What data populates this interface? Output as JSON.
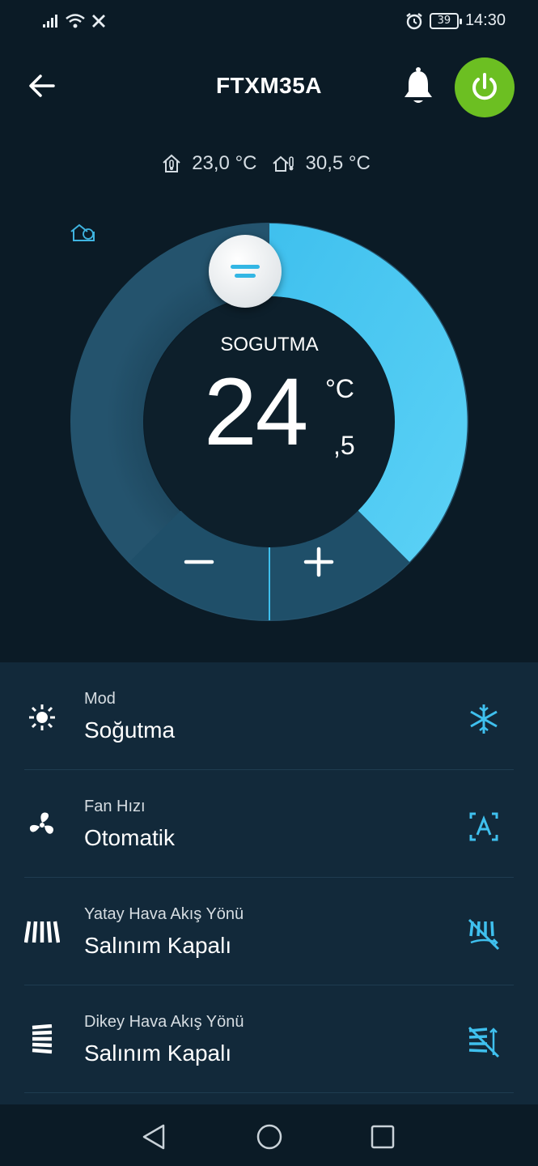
{
  "status_bar": {
    "time": "14:30",
    "battery": "39",
    "icons": [
      "signal-icon",
      "wifi-icon",
      "x-icon",
      "alarm-icon",
      "battery-icon"
    ]
  },
  "header": {
    "title": "FTXM35A",
    "power_color": "#6cbf22"
  },
  "readings": {
    "indoor_temp": "23,0 °C",
    "outdoor_temp": "30,5 °C"
  },
  "thermostat": {
    "mode_label": "SOGUTMA",
    "setpoint_whole": "24",
    "setpoint_unit": "°C",
    "setpoint_decimal": ",5",
    "accent_color": "#4fc9f2",
    "track_color": "#1d4a62"
  },
  "settings": [
    {
      "label": "Mod",
      "value": "Soğutma",
      "lead_icon": "mode-icon",
      "trail_icon": "snowflake-icon"
    },
    {
      "label": "Fan Hızı",
      "value": "Otomatik",
      "lead_icon": "fan-icon",
      "trail_icon": "fan-auto-icon"
    },
    {
      "label": "Yatay Hava Akış Yönü",
      "value": "Salınım Kapalı",
      "lead_icon": "horizontal-vanes-icon",
      "trail_icon": "horizontal-swing-off-icon"
    },
    {
      "label": "Dikey Hava Akış Yönü",
      "value": "Salınım Kapalı",
      "lead_icon": "vertical-vanes-icon",
      "trail_icon": "vertical-swing-off-icon"
    }
  ]
}
